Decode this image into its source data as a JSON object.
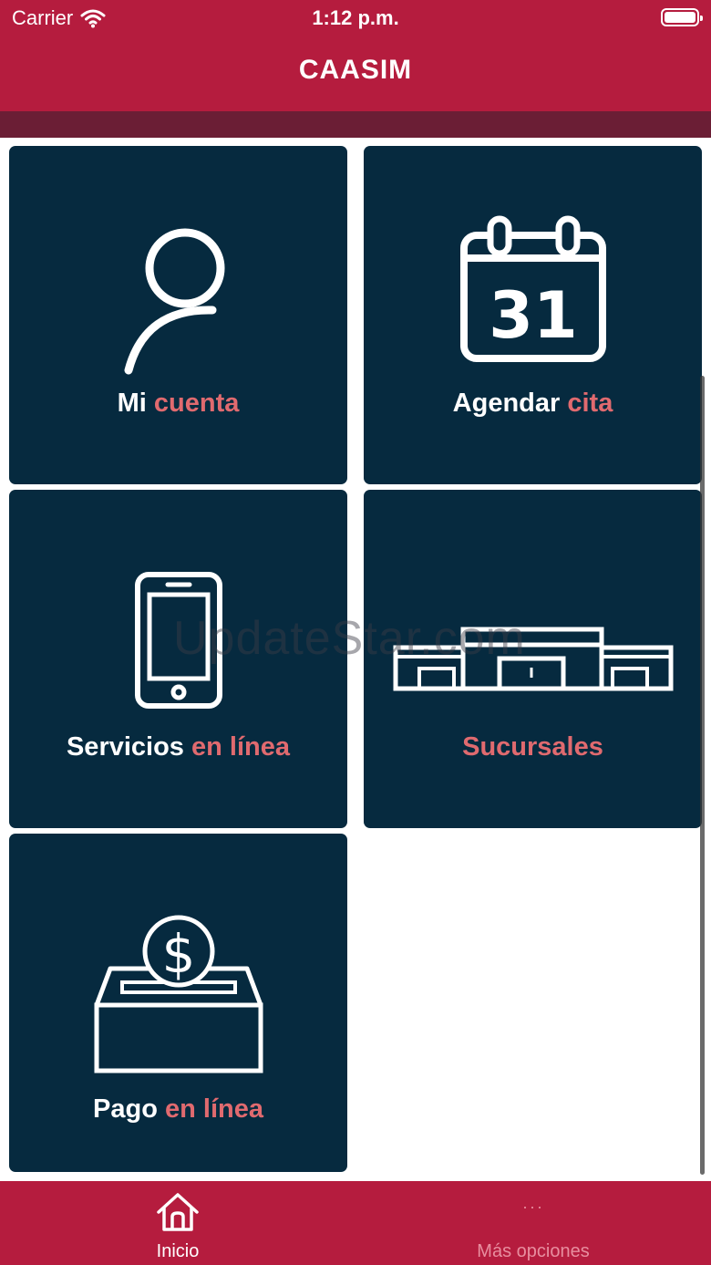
{
  "status_bar": {
    "carrier": "Carrier",
    "time": "1:12 p.m.",
    "wifi_icon": "wifi-icon",
    "battery_icon": "battery-icon"
  },
  "header": {
    "title": "CAASIM",
    "background_color": "#b51c3e"
  },
  "tiles": [
    {
      "icon": "user-icon",
      "label_white": "Mi",
      "label_red": "cuenta"
    },
    {
      "icon": "calendar-icon",
      "calendar_day": "31",
      "label_white": "Agendar",
      "label_red": "cita"
    },
    {
      "icon": "smartphone-icon",
      "label_white": "Servicios",
      "label_red": "en línea"
    },
    {
      "icon": "building-icon",
      "label_white": "",
      "label_red": "Sucursales"
    },
    {
      "icon": "payment-box-icon",
      "coin_symbol": "$",
      "label_white": "Pago",
      "label_red": "en línea"
    }
  ],
  "watermark": "UpdateStar.com",
  "tabbar": {
    "items": [
      {
        "icon": "home-icon",
        "label": "Inicio",
        "active": true
      },
      {
        "icon": "more-icon",
        "label": "Más opciones",
        "active": false
      }
    ]
  },
  "colors": {
    "tile_background": "#062a3f",
    "accent_red": "#e06a6f",
    "tabbar": "#b51c3e"
  }
}
